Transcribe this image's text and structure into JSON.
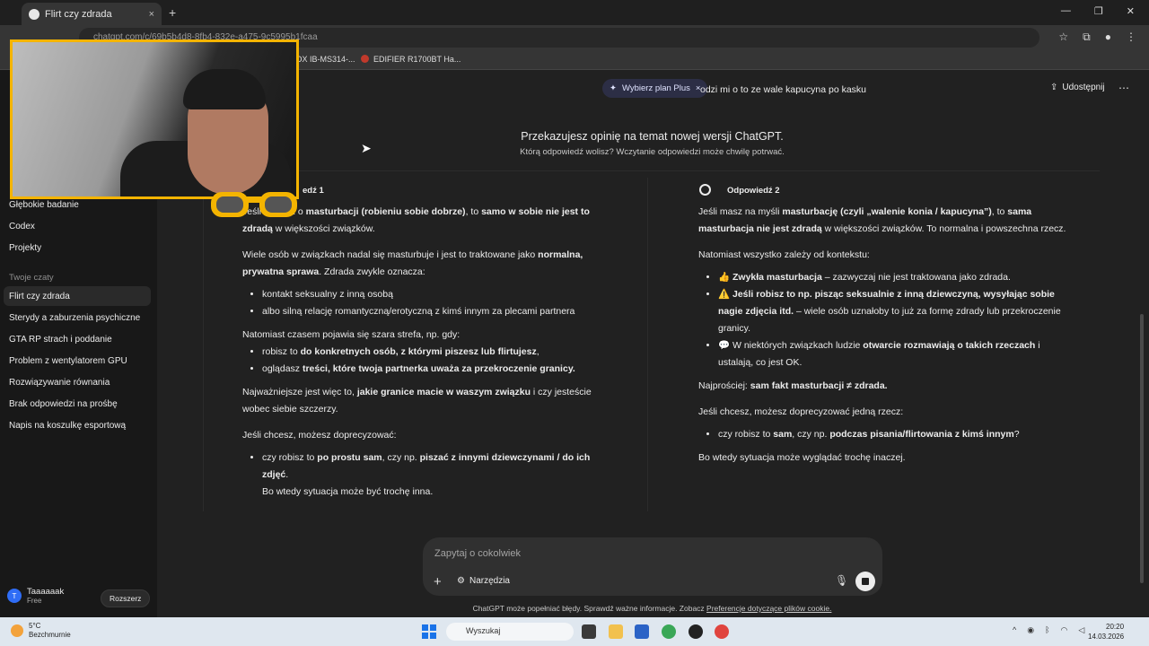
{
  "browser": {
    "tab_title": "Flirt czy zdrada",
    "tab_close": "×",
    "new_tab": "+",
    "url": "chatgpt.com/c/69b5b4d8-8fb4-832e-a475-9c5995b1fcaa",
    "bookmarks": [
      "DX IB-MS314-...",
      "EDIFIER R1700BT Ha..."
    ],
    "window_controls": [
      "—",
      "❐",
      "✕"
    ]
  },
  "sidebar": {
    "items_top": [
      "Głębokie badanie",
      "Codex",
      "Projekty"
    ],
    "section_title": "Twoje czaty",
    "chats": [
      "Flirt czy zdrada",
      "Sterydy a zaburzenia psychiczne",
      "GTA RP strach i poddanie",
      "Problem z wentylatorem GPU",
      "Rozwiązywanie równania",
      "Brak odpowiedzi na prośbę",
      "Napis na koszulkę esportową"
    ],
    "user": {
      "initial": "T",
      "name": "Taaaaaak",
      "plan": "Free",
      "upgrade_label": "Rozszerz"
    }
  },
  "header": {
    "plus_pill": "Wybierz plan Plus",
    "plus_close": "×",
    "previous_message": "odzi mi o to ze wale kapucyna po kasku",
    "share_label": "Udostępnij",
    "more": "⋯"
  },
  "feedback": {
    "title": "Przekazujesz opinię na temat nowej wersji ChatGPT.",
    "subtitle": "Którą odpowiedź wolisz? Wczytanie odpowiedzi może chwilę potrwać."
  },
  "answer1": {
    "label": "edź 1"
  },
  "answer2": {
    "label": "Odpowiedź 2"
  },
  "composer": {
    "placeholder": "Zapytaj o cokolwiek",
    "plus": "+",
    "tools_label": "Narzędzia"
  },
  "disclaimer": {
    "text": "ChatGPT może popełniać błędy. Sprawdź ważne informacje. Zobacz ",
    "link": "Preferencje dotyczące plików cookie."
  },
  "taskbar": {
    "weather_temp": "5°C",
    "weather_desc": "Bezchmurnie",
    "search_placeholder": "Wyszukaj",
    "time": "20:20",
    "date": "14.03.2026"
  },
  "colors": {
    "accent_pill": "#2c2e45",
    "cam_border": "#f4b400",
    "sidebar_bg": "#181818",
    "main_bg": "#212121"
  }
}
